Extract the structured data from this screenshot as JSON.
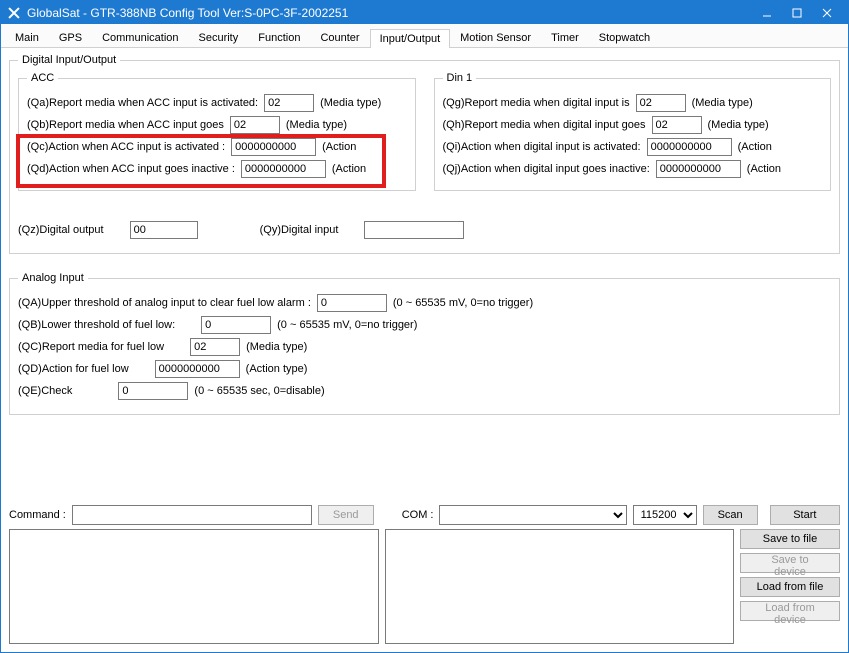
{
  "window": {
    "title": "GlobalSat - GTR-388NB Config Tool Ver:S-0PC-3F-2002251"
  },
  "tabs": {
    "items": [
      "Main",
      "GPS",
      "Communication",
      "Security",
      "Function",
      "Counter",
      "Input/Output",
      "Motion Sensor",
      "Timer",
      "Stopwatch"
    ],
    "active": "Input/Output"
  },
  "digital_io": {
    "legend": "Digital Input/Output",
    "acc": {
      "legend": "ACC",
      "qa_label": "(Qa)Report media when ACC input is activated:",
      "qa_value": "02",
      "qa_note": "(Media type)",
      "qb_label": "(Qb)Report media when ACC input goes",
      "qb_value": "02",
      "qb_note": "(Media type)",
      "qc_label": "(Qc)Action when ACC input is activated :",
      "qc_value": "0000000000",
      "qc_note": "(Action",
      "qd_label": "(Qd)Action when ACC input goes inactive :",
      "qd_value": "0000000000",
      "qd_note": "(Action"
    },
    "din1": {
      "legend": "Din 1",
      "qg_label": "(Qg)Report media when digital input is",
      "qg_value": "02",
      "qg_note": "(Media type)",
      "qh_label": "(Qh)Report media when digital input goes",
      "qh_value": "02",
      "qh_note": "(Media type)",
      "qi_label": "(Qi)Action when digital input is activated:",
      "qi_value": "0000000000",
      "qi_note": "(Action",
      "qj_label": "(Qj)Action when digital input goes inactive:",
      "qj_value": "0000000000",
      "qj_note": "(Action"
    },
    "qz_label": "(Qz)Digital output",
    "qz_value": "00",
    "qy_label": "(Qy)Digital input",
    "qy_value": ""
  },
  "analog": {
    "legend": "Analog Input",
    "qa_label": "(QA)Upper threshold of analog input to clear fuel low alarm :",
    "qa_value": "0",
    "qa_note": "(0 ~ 65535 mV, 0=no trigger)",
    "qb_label": "(QB)Lower threshold of fuel low:",
    "qb_value": "0",
    "qb_note": "(0 ~ 65535 mV, 0=no trigger)",
    "qc_label": "(QC)Report media for fuel low",
    "qc_value": "02",
    "qc_note": "(Media type)",
    "qd_label": "(QD)Action for fuel low",
    "qd_value": "0000000000",
    "qd_note": "(Action type)",
    "qe_label": "(QE)Check",
    "qe_value": "0",
    "qe_note": "(0 ~ 65535 sec, 0=disable)"
  },
  "bottom": {
    "command_label": "Command :",
    "command_value": "",
    "send_label": "Send",
    "com_label": "COM :",
    "com_value": "",
    "baud_value": "115200",
    "scan_label": "Scan",
    "start_label": "Start",
    "save_file": "Save to file",
    "save_device": "Save to device",
    "load_file": "Load from file",
    "load_device": "Load from device"
  }
}
